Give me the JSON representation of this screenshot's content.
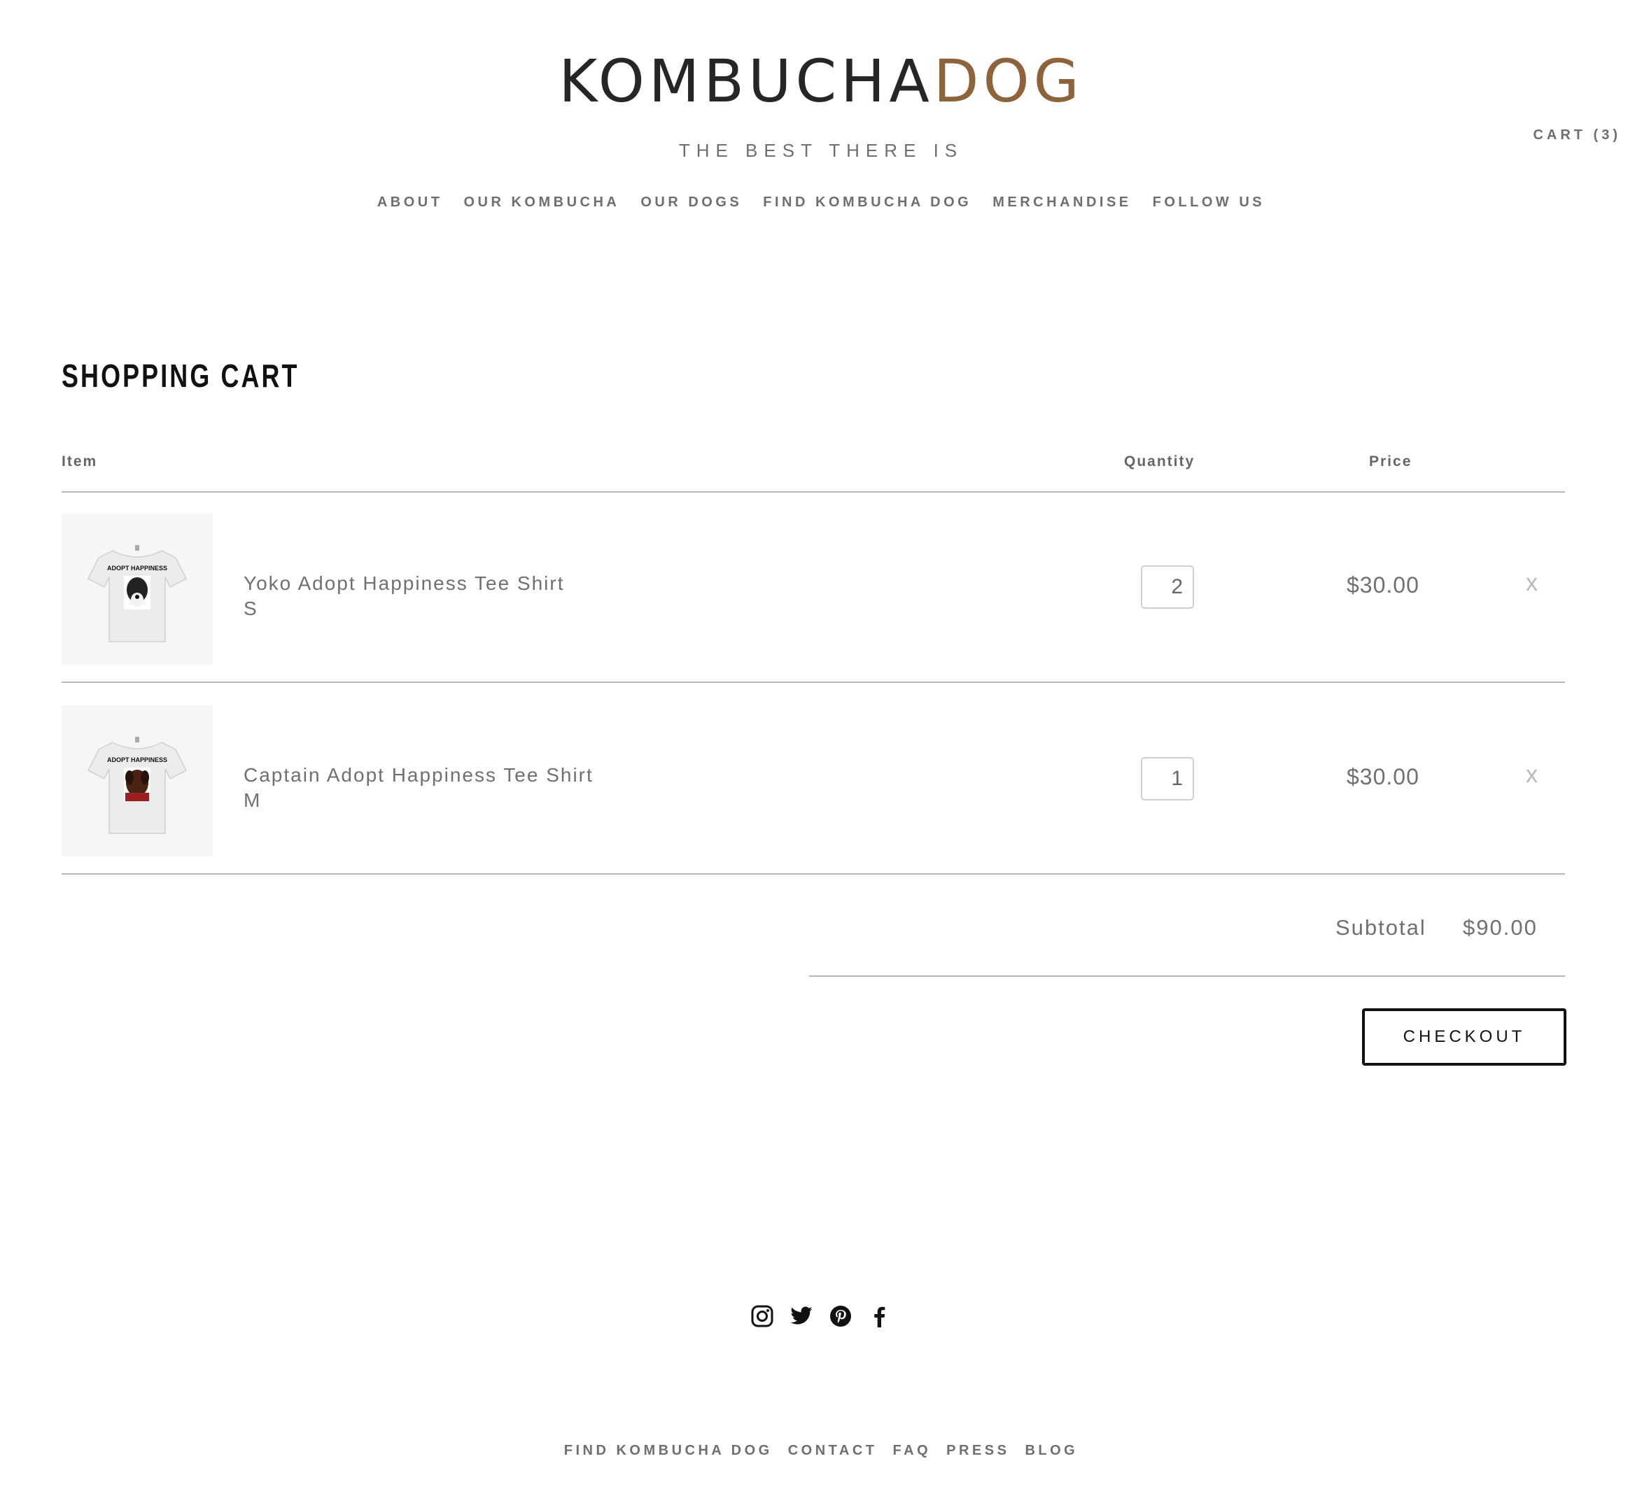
{
  "header": {
    "logo_part1": "KOMBUCHA",
    "logo_part2": "DOG",
    "tagline": "THE BEST THERE IS",
    "cart_label": "CART (3)",
    "nav": [
      "ABOUT",
      "OUR KOMBUCHA",
      "OUR DOGS",
      "FIND KOMBUCHA DOG",
      "MERCHANDISE",
      "FOLLOW US"
    ]
  },
  "cart": {
    "title": "SHOPPING CART",
    "columns": {
      "item": "Item",
      "quantity": "Quantity",
      "price": "Price"
    },
    "items": [
      {
        "name": "Yoko Adopt Happiness Tee Shirt",
        "variant": "S",
        "quantity": "2",
        "price": "$30.00",
        "remove": "x",
        "shirt_text": "ADOPT HAPPINESS"
      },
      {
        "name": "Captain Adopt Happiness Tee Shirt",
        "variant": "M",
        "quantity": "1",
        "price": "$30.00",
        "remove": "x",
        "shirt_text": "ADOPT HAPPINESS"
      }
    ],
    "subtotal_label": "Subtotal",
    "subtotal_value": "$90.00",
    "checkout_label": "CHECKOUT"
  },
  "footer": {
    "social": [
      "instagram-icon",
      "twitter-icon",
      "pinterest-icon",
      "facebook-icon"
    ],
    "links": [
      "FIND KOMBUCHA DOG",
      "CONTACT",
      "FAQ",
      "PRESS",
      "BLOG"
    ]
  },
  "colors": {
    "brand_dark": "#262626",
    "brand_accent": "#8f6339",
    "text_gray": "#707070"
  }
}
